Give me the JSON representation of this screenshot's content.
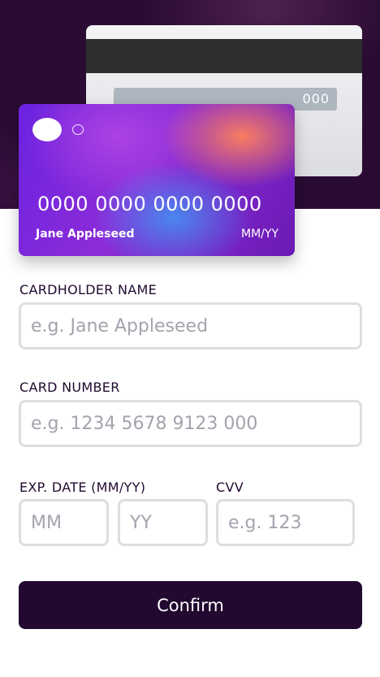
{
  "card_back": {
    "cvv": "000"
  },
  "card_front": {
    "number": "0000 0000 0000 0000",
    "name": "Jane Appleseed",
    "expiry": "MM/YY"
  },
  "form": {
    "cardholder_name": {
      "label": "CARDHOLDER NAME",
      "placeholder": "e.g. Jane Appleseed",
      "value": ""
    },
    "card_number": {
      "label": "CARD NUMBER",
      "placeholder": "e.g. 1234 5678 9123 000",
      "value": ""
    },
    "exp_date": {
      "label": "EXP. DATE (MM/YY)",
      "month_placeholder": "MM",
      "year_placeholder": "YY"
    },
    "cvc": {
      "label": "CVV",
      "placeholder": "e.g. 123"
    },
    "confirm_label": "Confirm"
  },
  "colors": {
    "hero_background": "#2a0b33",
    "primary_dark": "#21092f",
    "input_border": "#dedddf",
    "placeholder": "#a3a3ad"
  }
}
